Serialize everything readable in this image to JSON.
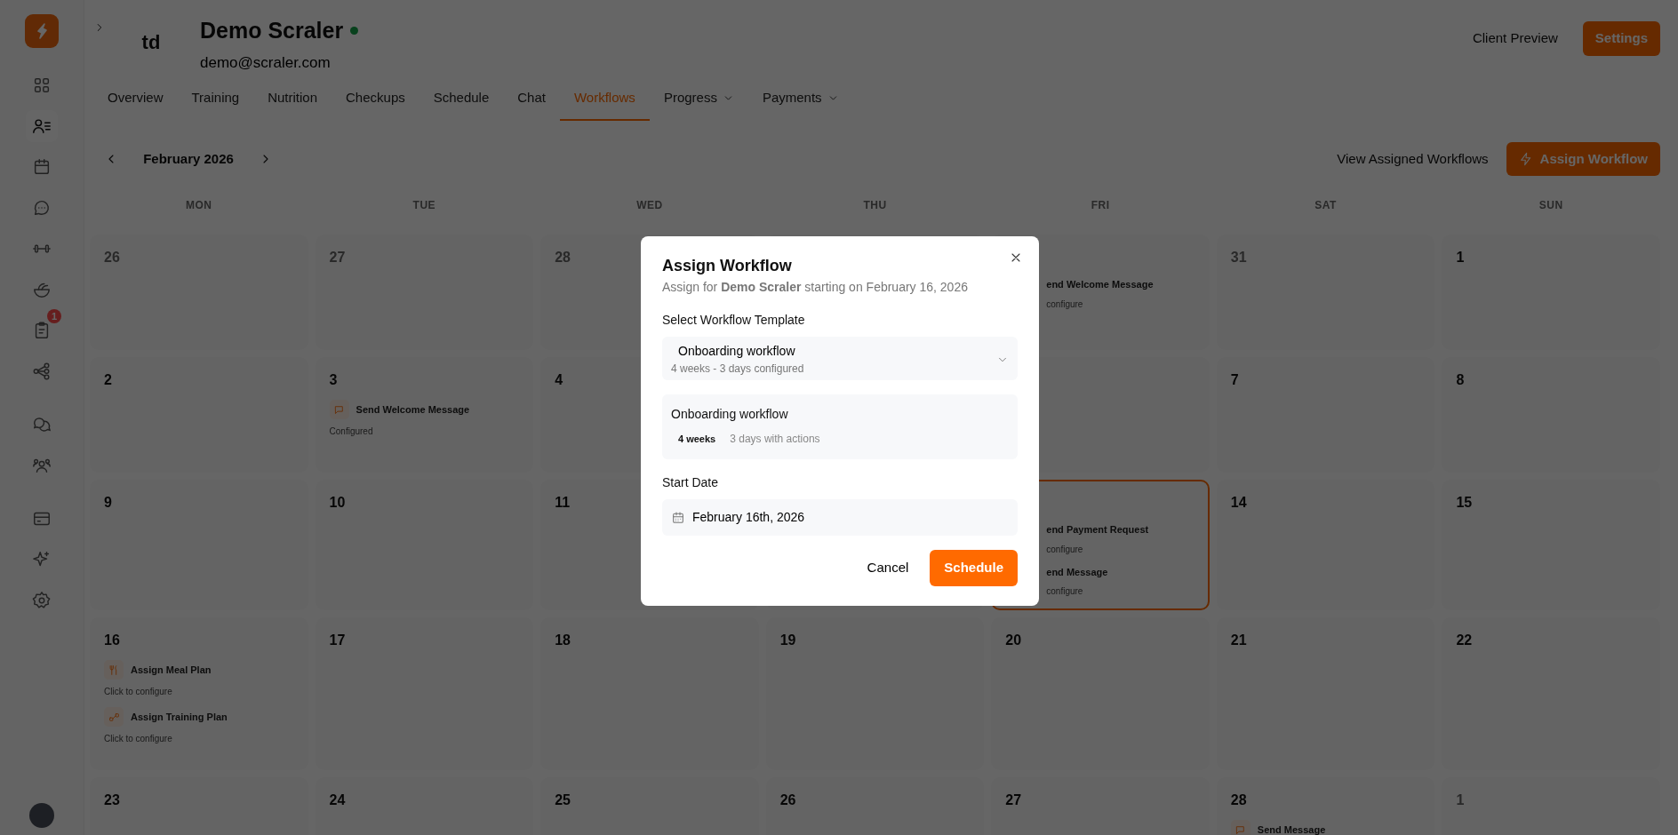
{
  "sidebar": {
    "logo": true,
    "sections": [
      [
        {
          "kind": "grid",
          "selected": false
        },
        {
          "kind": "users",
          "selected": true
        },
        {
          "kind": "calendar",
          "selected": false
        },
        {
          "kind": "chat",
          "selected": false
        },
        {
          "kind": "dumbbell",
          "selected": false
        },
        {
          "kind": "bowl",
          "selected": false
        },
        {
          "kind": "clipboard",
          "selected": false,
          "badge": "1"
        },
        {
          "kind": "nodes",
          "selected": false
        }
      ],
      [
        {
          "kind": "chats",
          "selected": false
        },
        {
          "kind": "group",
          "selected": false
        }
      ],
      [
        {
          "kind": "card",
          "selected": false
        },
        {
          "kind": "sparkle",
          "selected": false
        },
        {
          "kind": "gear",
          "selected": false
        }
      ]
    ]
  },
  "client": {
    "initials": "td",
    "name": "Demo Scraler",
    "online": true,
    "email": "demo@scraler.com"
  },
  "header_actions": {
    "preview": "Client Preview",
    "settings": "Settings"
  },
  "tabs": [
    {
      "label": "Overview",
      "selected": false,
      "dropdown": false
    },
    {
      "label": "Training",
      "selected": false,
      "dropdown": false
    },
    {
      "label": "Nutrition",
      "selected": false,
      "dropdown": false
    },
    {
      "label": "Checkups",
      "selected": false,
      "dropdown": false
    },
    {
      "label": "Schedule",
      "selected": false,
      "dropdown": false
    },
    {
      "label": "Chat",
      "selected": false,
      "dropdown": false
    },
    {
      "label": "Workflows",
      "selected": true,
      "dropdown": false
    },
    {
      "label": "Progress",
      "selected": false,
      "dropdown": true
    },
    {
      "label": "Payments",
      "selected": false,
      "dropdown": true
    }
  ],
  "calendar": {
    "month": "February 2026",
    "view_assigned": "View Assigned Workflows",
    "assign": "Assign Workflow",
    "weekdays": [
      "MON",
      "TUE",
      "WED",
      "THU",
      "FRI",
      "SAT",
      "SUN"
    ],
    "weeks": [
      {
        "mon": {
          "day": "26",
          "outside": true
        },
        "tue": {
          "day": "27",
          "outside": true
        },
        "wed": {
          "day": "28",
          "outside": true
        },
        "fri": {
          "items": [
            {
              "title": "end Welcome Message",
              "status": "configure"
            }
          ]
        },
        "sat": {
          "day": "31",
          "outside": true
        },
        "sun": {
          "day": "1",
          "outside": false
        }
      },
      {
        "mon": {
          "day": "2",
          "outside": false
        },
        "tue": {
          "day": "3",
          "outside": false,
          "items": [
            {
              "kind": "message",
              "title": "Send Welcome Message",
              "status": "Configured"
            }
          ]
        },
        "wed": {
          "day": "4",
          "outside": false
        },
        "sat": {
          "day": "7",
          "outside": false
        },
        "sun": {
          "day": "8",
          "outside": false
        }
      },
      {
        "mon": {
          "day": "9",
          "outside": false
        },
        "tue": {
          "day": "10",
          "outside": false
        },
        "wed": {
          "day": "11",
          "outside": false
        },
        "fri": {
          "highlighted": true,
          "items": [
            {
              "title": "end Payment Request",
              "status": "configure"
            },
            {
              "title": "end Message",
              "status": "configure"
            }
          ]
        },
        "sat": {
          "day": "14",
          "outside": false
        },
        "sun": {
          "day": "15",
          "outside": false
        }
      },
      {
        "mon": {
          "day": "16",
          "outside": false,
          "items": [
            {
              "kind": "meal",
              "title": "Assign Meal Plan",
              "status": "Click to configure"
            },
            {
              "kind": "training",
              "title": "Assign Training Plan",
              "status": "Click to configure"
            }
          ]
        },
        "tue": {
          "day": "17",
          "outside": false
        },
        "wed": {
          "day": "18",
          "outside": false
        },
        "thu": {
          "day": "19",
          "outside": false
        },
        "fri": {
          "day": "20",
          "outside": false
        },
        "sat": {
          "day": "21",
          "outside": false
        },
        "sun": {
          "day": "22",
          "outside": false
        }
      },
      {
        "mon": {
          "day": "23",
          "outside": false
        },
        "tue": {
          "day": "24",
          "outside": false
        },
        "wed": {
          "day": "25",
          "outside": false
        },
        "thu": {
          "day": "26",
          "outside": false
        },
        "fri": {
          "day": "27",
          "outside": false
        },
        "sat": {
          "day": "28",
          "outside": false,
          "items": [
            {
              "kind": "message",
              "title": "Send Message"
            }
          ]
        },
        "sun": {
          "day": "1",
          "outside": true
        }
      }
    ]
  },
  "modal": {
    "title": "Assign Workflow",
    "subtitle": "Assign for **Demo Scraler** starting on February 16, 2026",
    "template_label": "Select Workflow Template",
    "template": {
      "value": "Onboarding workflow",
      "detail": "4 weeks - 3 days configured"
    },
    "summary": {
      "name": "Onboarding workflow",
      "duration": "4 weeks",
      "detail": "3 days with actions"
    },
    "date_label": "Start Date",
    "date": "February 16th, 2026",
    "cancel": "Cancel",
    "submit": "Schedule"
  }
}
